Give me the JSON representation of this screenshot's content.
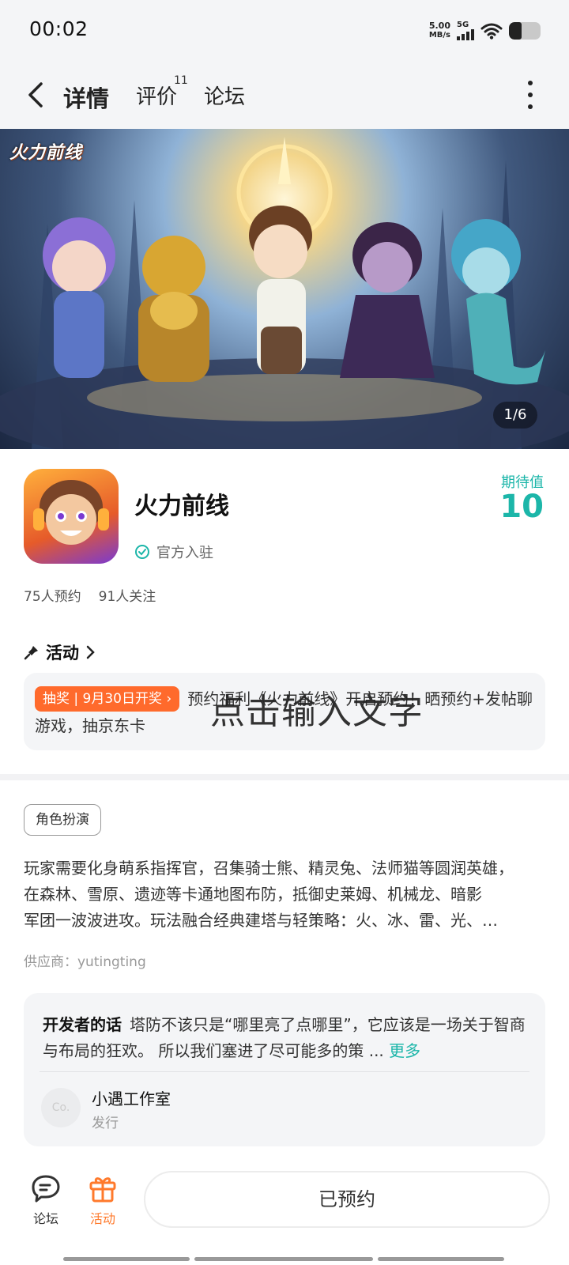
{
  "status_bar": {
    "time": "00:02",
    "net_speed": "5.00",
    "net_unit": "MB/s",
    "network": "5G",
    "battery_level": 0.4
  },
  "nav": {
    "tabs": [
      {
        "label": "详情",
        "active": true
      },
      {
        "label": "评价",
        "badge": "11"
      },
      {
        "label": "论坛"
      }
    ]
  },
  "banner": {
    "logo_text": "火力前线",
    "counter": "1/6"
  },
  "game": {
    "name": "火力前线",
    "official_label": "官方入驻",
    "expect_label": "期待值",
    "expect_value": "10",
    "reservations": "75人预约",
    "followers": "91人关注"
  },
  "activity": {
    "heading": "活动",
    "badge": "抽奖 | 9月30日开奖",
    "text": "预约福利《火力前线》开启预约！晒预约+发帖聊游戏，抽京东卡",
    "overlay_text": "点击输入文字"
  },
  "description": {
    "genre": "角色扮演",
    "lines": [
      "玩家需要化身萌系指挥官，召集骑士熊、精灵兔、法师猫等圆润英雄，",
      "在森林、雪原、遗迹等卡通地图布防，抵御史莱姆、机械龙、暗影",
      "军团一波波进攻。玩法融合经典建塔与轻策略：火、冰、雷、光、…"
    ],
    "supplier": "供应商：yutingting"
  },
  "developer": {
    "heading": "开发者的话",
    "text": "塔防不该只是“哪里亮了点哪里”，它应该是一场关于智商与布局的狂欢。 所以我们塞进了尽可能多的策 ...",
    "more": "更多",
    "avatar_text": "Co.",
    "studio": "小遇工作室",
    "role": "发行"
  },
  "bottom_bar": {
    "forum_label": "论坛",
    "activity_label": "活动",
    "reserved_label": "已预约"
  },
  "colors": {
    "accent": "#1cb6a9",
    "orange": "#ff6a2c",
    "background": "#f4f5f7"
  }
}
